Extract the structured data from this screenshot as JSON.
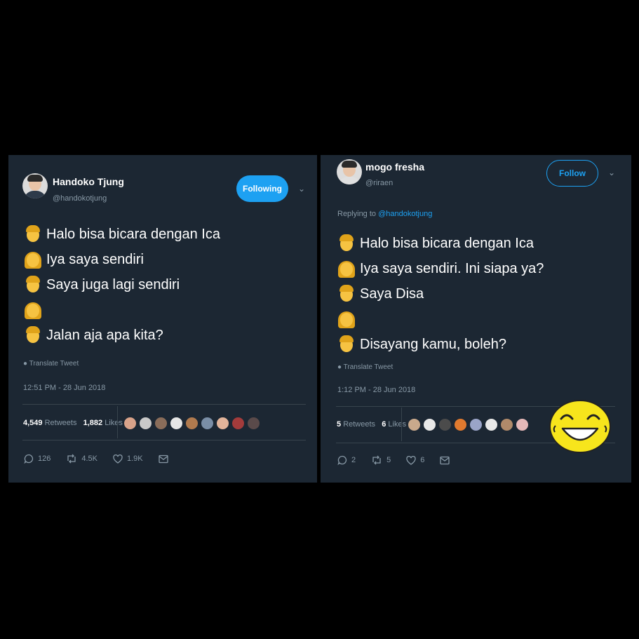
{
  "tweet1": {
    "name": "Handoko Tjung",
    "handle": "@handokotjung",
    "follow_label": "Following",
    "lines": [
      {
        "emoji": "man-emoji",
        "text": "Halo bisa bicara dengan Ica"
      },
      {
        "emoji": "woman-emoji",
        "text": "Iya saya sendiri"
      },
      {
        "emoji": "man-emoji",
        "text": "Saya juga lagi sendiri"
      },
      {
        "emoji": "woman-emoji",
        "text": ""
      },
      {
        "emoji": "man-emoji",
        "text": "Jalan aja apa kita?"
      }
    ],
    "translate": "Translate Tweet",
    "time": "12:51 PM - 28 Jun 2018",
    "retweets": "4,549",
    "retweets_label": "Retweets",
    "likes": "1,882",
    "likes_label": "Likes",
    "replies_count": "126",
    "retweets_count": "4.5K",
    "likes_count": "1.9K"
  },
  "tweet2": {
    "name": "mogo fresha",
    "handle": "@riraen",
    "follow_label": "Follow",
    "replying_prefix": "Replying to",
    "replying_to": "@handokotjung",
    "lines": [
      {
        "emoji": "man-emoji",
        "text": "Halo bisa bicara dengan Ica"
      },
      {
        "emoji": "woman-emoji",
        "text": "Iya saya sendiri. Ini siapa ya?"
      },
      {
        "emoji": "man-emoji",
        "text": "Saya Disa"
      },
      {
        "emoji": "woman-emoji",
        "text": ""
      },
      {
        "emoji": "man-emoji",
        "text": "Disayang kamu, boleh?"
      }
    ],
    "translate": "Translate Tweet",
    "time": "1:12 PM - 28 Jun 2018",
    "retweets": "5",
    "retweets_label": "Retweets",
    "likes": "6",
    "likes_label": "Likes",
    "replies_count": "2",
    "retweets_count": "5",
    "likes_count": "6"
  },
  "colors": {
    "background": "#000000",
    "panel": "#1c2733",
    "accent": "#1da1f2",
    "muted": "#8899a6",
    "emoji_yellow": "#f6c342"
  },
  "icons": [
    "chevron-down-icon",
    "globe-icon",
    "reply-icon",
    "retweet-icon",
    "heart-icon",
    "message-icon",
    "laughing-smiley-icon"
  ]
}
